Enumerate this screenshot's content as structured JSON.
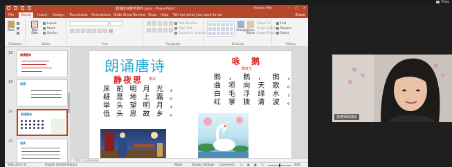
{
  "meeting": {
    "view_label": "View",
    "participant_name": "张老师的演示"
  },
  "ppt": {
    "window_title": "朗诵唐诗教学课件.pptx - PowerPoint",
    "user": "Henny Min",
    "window_controls": [
      "—",
      "□",
      "✕"
    ],
    "tabs": [
      "File",
      "Home",
      "Insert",
      "Design",
      "Transitions",
      "Animations",
      "Slide Show",
      "Review",
      "View",
      "Help",
      "Tell me what you want to do"
    ],
    "active_tab": "Home",
    "share_label": "Share",
    "ribbon": {
      "clipboard": {
        "paste": "Paste",
        "label": "Clipboard"
      },
      "slides": {
        "new_slide": "New Slide",
        "layout": "Layout",
        "reset": "Reset",
        "section": "Section",
        "label": "Slides"
      },
      "font": {
        "label": "Font"
      },
      "paragraph": {
        "label": "Paragraph",
        "text_direction": "Text Direction",
        "align_text": "Align Text",
        "convert_smartart": "Convert to SmartArt"
      },
      "drawing": {
        "arrange": "Arrange",
        "quick_styles": "Quick Styles",
        "shape_fill": "Shape Fill",
        "shape_outline": "Shape Outline",
        "shape_effects": "Shape Effects",
        "label": "Drawing"
      },
      "editing": {
        "find": "Find",
        "replace": "Replace",
        "select": "Select",
        "label": "Editing"
      }
    },
    "thumbnails": [
      {
        "num": "18",
        "title": "朗诵唐诗",
        "selected": false
      },
      {
        "num": "19",
        "title": "朗诵",
        "selected": false
      },
      {
        "num": "20",
        "title": "朗诵唐诗",
        "selected": true
      },
      {
        "num": "21",
        "title": "测读",
        "selected": false
      }
    ],
    "slide": {
      "heading": "朗诵唐诗",
      "poem1": {
        "title": "静夜思",
        "author": "李白",
        "lines": [
          "床 前 明 月 光 ，",
          "疑 是 地 上 霜 。",
          "举 头 望 明 月 ，",
          "低 头 思 故 乡 。"
        ]
      },
      "poem2": {
        "title": "咏 鹅",
        "author": "骆宾王",
        "lines": [
          "鹅 ， 鹅 ， 鹅 ，",
          "曲 项 向 天 歌 。",
          "白 毛 浮 绿 水 ，",
          "红 掌 拨 清 波 。"
        ]
      }
    },
    "notes_placeholder": "Click to add notes",
    "status": {
      "slide_info": "Slide 20 of 31",
      "language": "English (United States)",
      "notes": "Notes",
      "display_settings": "Display Settings",
      "comments": "Comments",
      "zoom": "43%"
    }
  },
  "colors": {
    "ppt_accent": "#b7472a",
    "heading_blue": "#29a8cf",
    "poem_red": "#dd2222"
  }
}
